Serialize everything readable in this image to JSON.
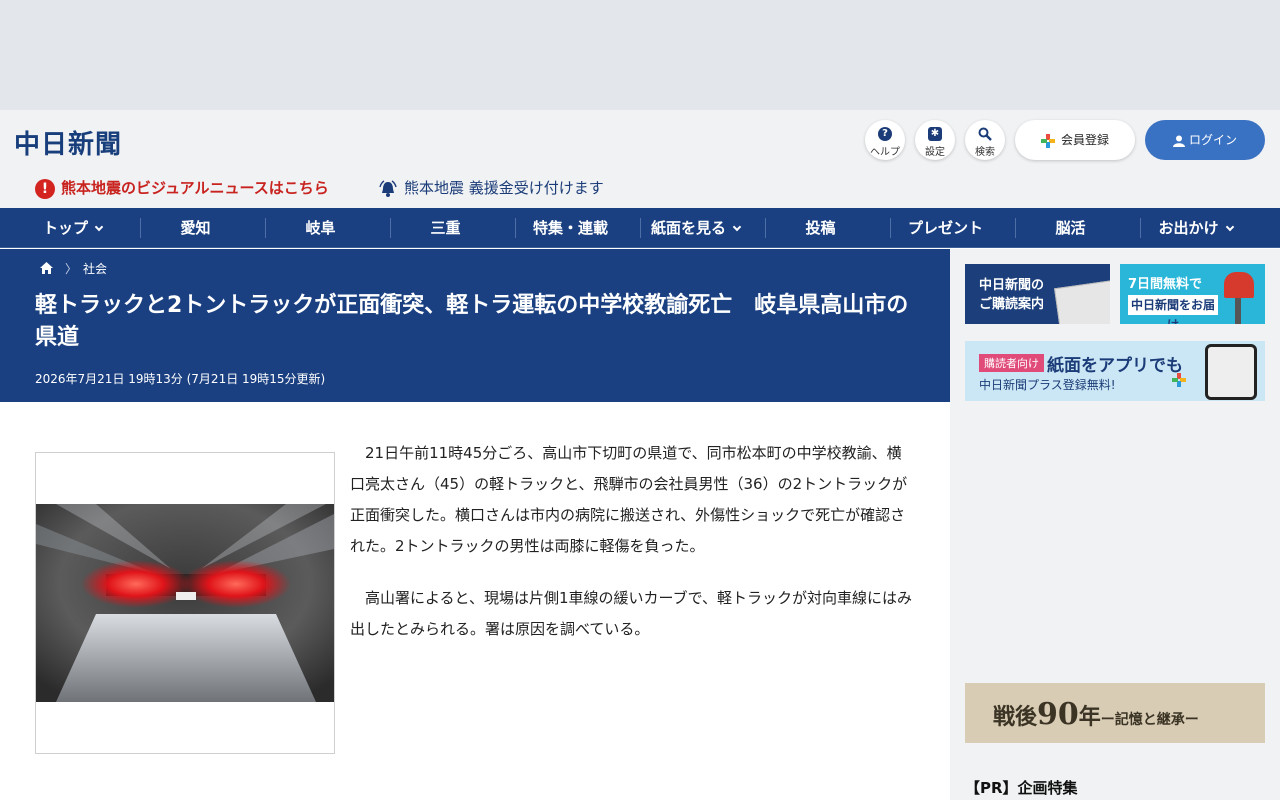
{
  "header": {
    "logo": "中日新聞",
    "help_label": "ヘルプ",
    "settings_label": "設定",
    "search_label": "検索",
    "member_label": "会員登録",
    "login_label": "ログイン"
  },
  "alerts": {
    "visual_news": "熊本地震のビジュアルニュースはこちら",
    "donation": "熊本地震 義援金受け付けます"
  },
  "nav": {
    "items": [
      {
        "label": "トップ"
      },
      {
        "label": "愛知"
      },
      {
        "label": "岐阜"
      },
      {
        "label": "三重"
      },
      {
        "label": "特集・連載"
      },
      {
        "label": "紙面を見る"
      },
      {
        "label": "投稿"
      },
      {
        "label": "プレゼント"
      },
      {
        "label": "脳活"
      },
      {
        "label": "お出かけ"
      }
    ]
  },
  "article": {
    "breadcrumb": "社会",
    "title": "軽トラックと2トントラックが正面衝突、軽トラ運転の中学校教諭死亡　岐阜県高山市の県道",
    "date": "2026年7月21日 19時13分 (7月21日 19時15分更新)",
    "paragraphs": [
      "21日午前11時45分ごろ、高山市下切町の県道で、同市松本町の中学校教諭、横口亮太さん（45）の軽トラックと、飛騨市の会社員男性（36）の2トントラックが正面衝突した。横口さんは市内の病院に搬送され、外傷性ショックで死亡が確認された。2トントラックの男性は両膝に軽傷を負った。",
      "高山署によると、現場は片側1車線の緩いカーブで、軽トラックが対向車線にはみ出したとみられる。署は原因を調べている。"
    ]
  },
  "sidebar": {
    "banner_subscribe": {
      "line1": "中日新聞の",
      "line2": "ご購読案内"
    },
    "banner_trial": {
      "line1": "7日間無料で",
      "line2": "中日新聞をお届け"
    },
    "banner_app": {
      "tag": "購読者向け",
      "line1": "紙面をアプリでも",
      "line2": "中日新聞プラス登録無料!"
    },
    "banner_war": {
      "a": "戦後",
      "b": "90",
      "c": "年",
      "d": "ー記憶と継承ー"
    },
    "pr_heading": "【PR】企画特集"
  }
}
